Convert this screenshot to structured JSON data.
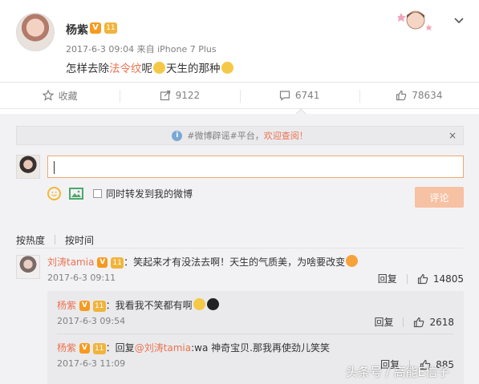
{
  "post": {
    "username": "杨紫",
    "v_badge": "V",
    "vip_badge": "11",
    "meta": "2017-6-3 09:04 来自 iPhone 7 Plus",
    "content_before": "怎样去除",
    "content_highlight": "法令纹",
    "content_mid": "呢",
    "content_after": "天生的那种"
  },
  "actions": {
    "favorite_label": "收藏",
    "repost_count": "9122",
    "comment_count": "6741",
    "like_count": "78634"
  },
  "notice": {
    "prefix": "#微博辟谣#平台，",
    "highlight": "欢迎查阅！",
    "close": "×"
  },
  "composer": {
    "repost_label": "同时转发到我的微博",
    "submit_label": "评论"
  },
  "sort": {
    "hot": "按热度",
    "time": "按时间"
  },
  "comments": [
    {
      "name": "刘涛tamia",
      "vip": "11",
      "text": "：笑起来才有没法去啊！天生的气质美，为啥要改变",
      "date": "2017-6-3 09:11",
      "reply": "回复",
      "likes": "14805"
    }
  ],
  "replies": [
    {
      "name": "杨紫",
      "vip": "11",
      "text": "：我看我不笑都有啊",
      "date": "2017-6-3 09:54",
      "reply": "回复",
      "likes": "2618"
    },
    {
      "name": "杨紫",
      "vip": "11",
      "prefix": "：回复",
      "mention": "@刘涛tamia",
      "text": ":wa 神奇宝贝.那我再使劲儿笑笑",
      "date": "2017-6-3 11:09",
      "reply": "回复",
      "likes": "885"
    }
  ],
  "watermark": "头条号 / 高能E信子",
  "colors": {
    "accent": "#eb7350",
    "vbadge": "#f79a1f",
    "submit": "#f7c1a4"
  }
}
